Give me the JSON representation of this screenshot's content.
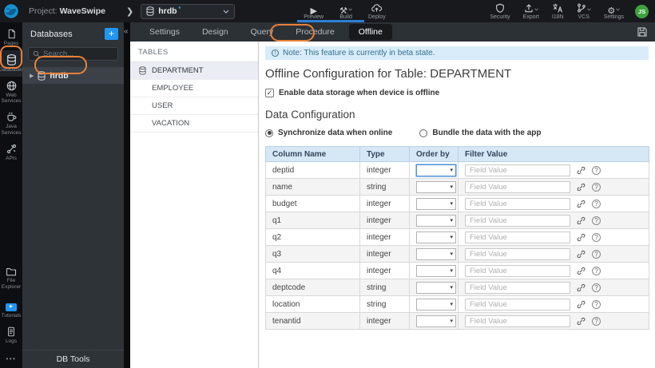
{
  "colors": {
    "accent_blue": "#2196f3",
    "annotation_orange": "#e8813a",
    "note_bg": "#d9ecf9",
    "table_header_bg": "#d6e7f6"
  },
  "top_bar": {
    "project_label": "Project:",
    "project_name": "WaveSwipe",
    "db_selector_value": "hrdb",
    "db_selector_modified_marker": "*",
    "actions_left": [
      {
        "label": "Preview",
        "icon": "play-icon",
        "caret": false
      },
      {
        "label": "Build",
        "icon": "build-icon",
        "caret": true
      },
      {
        "label": "Deploy",
        "icon": "deploy-icon",
        "caret": false
      }
    ],
    "actions_right": [
      {
        "label": "Security",
        "icon": "security-icon",
        "caret": false
      },
      {
        "label": "Export",
        "icon": "export-icon",
        "caret": true
      },
      {
        "label": "I18N",
        "icon": "i18n-icon",
        "caret": false
      },
      {
        "label": "VCS",
        "icon": "vcs-icon",
        "caret": true
      },
      {
        "label": "Settings",
        "icon": "settings-icon",
        "caret": true
      }
    ],
    "avatar_initials": "JS"
  },
  "left_nav": {
    "top_items": [
      {
        "label": "Pages",
        "icon": "pages-icon",
        "active": false
      },
      {
        "label": "Databases",
        "icon": "database-icon",
        "active": true
      },
      {
        "label": "Web Services",
        "icon": "web-services-icon",
        "active": false
      },
      {
        "label": "Java Services",
        "icon": "java-services-icon",
        "active": false
      },
      {
        "label": "APIs",
        "icon": "apis-icon",
        "active": false
      }
    ],
    "bottom_items": [
      {
        "label": "File Explorer",
        "icon": "file-explorer-icon",
        "active": false
      },
      {
        "label": "Tutorials",
        "icon": "tutorials-icon",
        "active": false
      },
      {
        "label": "Logs",
        "icon": "logs-icon",
        "active": false
      }
    ],
    "more_label": "•••"
  },
  "db_panel": {
    "title": "Databases",
    "add_button_label": "+",
    "collapse_label": "«",
    "search_placeholder": "Search...",
    "items": [
      {
        "label": "hrdb"
      }
    ],
    "footer_label": "DB Tools"
  },
  "tab_bar": {
    "tabs": [
      {
        "label": "Settings",
        "active": false
      },
      {
        "label": "Design",
        "active": false
      },
      {
        "label": "Query",
        "active": false
      },
      {
        "label": "Procedure",
        "active": false
      },
      {
        "label": "Offline",
        "active": true
      }
    ]
  },
  "tables_panel": {
    "title": "TABLES",
    "items": [
      {
        "label": "DEPARTMENT",
        "selected": true
      },
      {
        "label": "EMPLOYEE",
        "selected": false
      },
      {
        "label": "USER",
        "selected": false
      },
      {
        "label": "VACATION",
        "selected": false
      }
    ]
  },
  "main": {
    "note_text": "Note: This feature is currently in beta state.",
    "page_title": "Offline Configuration for Table: DEPARTMENT",
    "enable_label": "Enable data storage when device is offline",
    "enable_checked": true,
    "section_title": "Data Configuration",
    "sync_options": [
      {
        "label": "Synchronize data when online",
        "selected": true
      },
      {
        "label": "Bundle the data with the app",
        "selected": false
      }
    ],
    "table": {
      "headers": [
        "Column Name",
        "Type",
        "Order by",
        "Filter Value"
      ],
      "filter_placeholder": "Field Value",
      "rows": [
        {
          "column_name": "deptid",
          "type": "integer"
        },
        {
          "column_name": "name",
          "type": "string"
        },
        {
          "column_name": "budget",
          "type": "integer"
        },
        {
          "column_name": "q1",
          "type": "integer"
        },
        {
          "column_name": "q2",
          "type": "integer"
        },
        {
          "column_name": "q3",
          "type": "integer"
        },
        {
          "column_name": "q4",
          "type": "integer"
        },
        {
          "column_name": "deptcode",
          "type": "string"
        },
        {
          "column_name": "location",
          "type": "string"
        },
        {
          "column_name": "tenantid",
          "type": "integer"
        }
      ]
    }
  }
}
